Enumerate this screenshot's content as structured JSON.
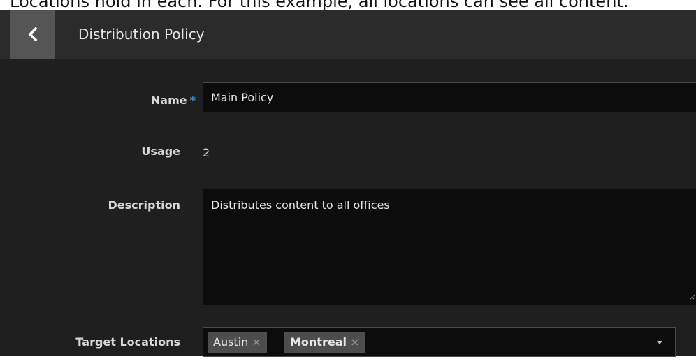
{
  "caption_text": "Locations hold in each. For this example, all locations can see all content.",
  "header": {
    "title": "Distribution Policy",
    "back_icon": "chevron-left-icon"
  },
  "form": {
    "name": {
      "label": "Name",
      "required_marker": "*",
      "value": "Main Policy"
    },
    "usage": {
      "label": "Usage",
      "value": "2"
    },
    "description": {
      "label": "Description",
      "value": "Distributes content to all offices"
    },
    "target_locations": {
      "label": "Target Locations",
      "tags": [
        {
          "label": "Austin",
          "remove": "×"
        },
        {
          "label": "Montreal",
          "remove": "×"
        }
      ]
    }
  },
  "colors": {
    "panel_bg": "#1f1f1f",
    "header_bg": "#2b2b2b",
    "back_button_bg": "#555555",
    "input_bg": "#0c0c0c",
    "required_accent": "#3b8fd6",
    "tag_bg": "#4d4d4d"
  }
}
